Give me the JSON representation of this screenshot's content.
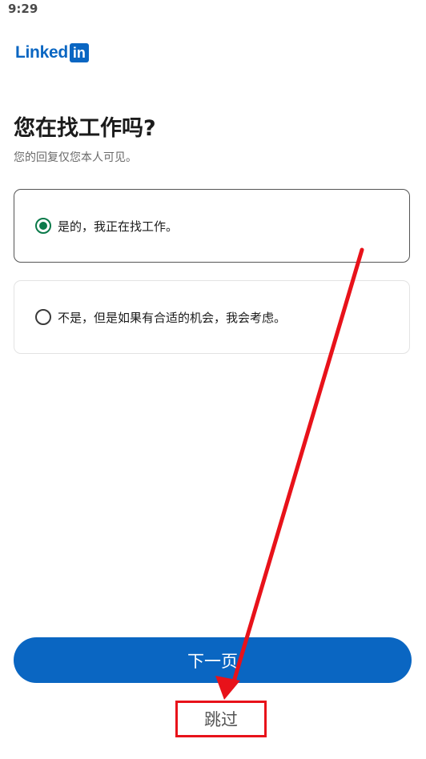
{
  "status_bar": {
    "time": "9:29"
  },
  "logo": {
    "text": "Linked",
    "badge": "in",
    "color": "#0a66c2"
  },
  "header": {
    "title": "您在找工作吗?",
    "subtitle": "您的回复仅您本人可见。"
  },
  "options": [
    {
      "label": "是的，我正在找工作。",
      "selected": true
    },
    {
      "label": "不是，但是如果有合适的机会，我会考虑。",
      "selected": false
    }
  ],
  "actions": {
    "next_label": "下一页",
    "skip_label": "跳过"
  },
  "colors": {
    "primary": "#0a66c2",
    "radio_selected": "#0b7a4a",
    "annotation": "#e8121a"
  }
}
